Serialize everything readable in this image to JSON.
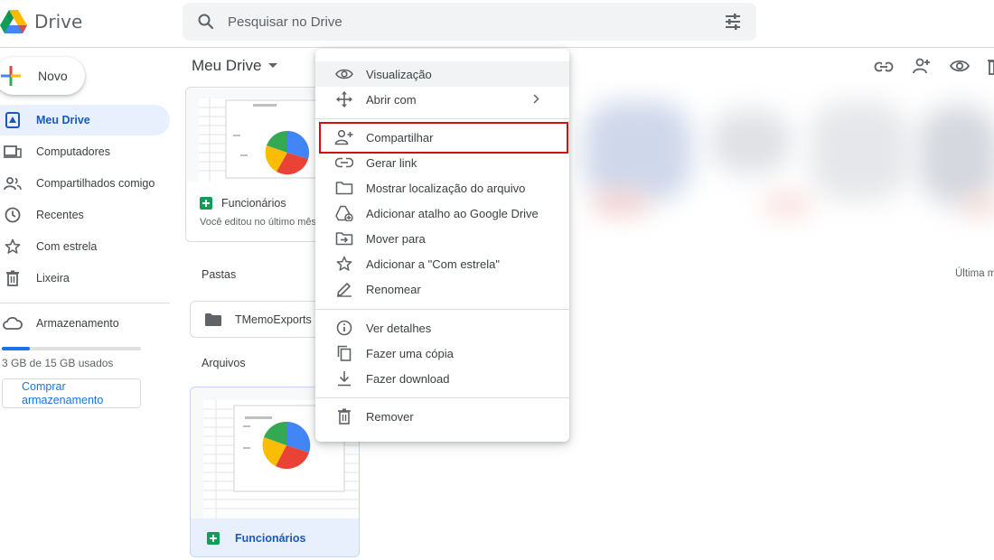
{
  "app": {
    "name": "Drive"
  },
  "search": {
    "placeholder": "Pesquisar no Drive"
  },
  "sidebar": {
    "new_label": "Novo",
    "items": [
      {
        "label": "Meu Drive",
        "icon": "my-drive-icon",
        "active": true
      },
      {
        "label": "Computadores",
        "icon": "computer-icon"
      },
      {
        "label": "Compartilhados comigo",
        "icon": "people-icon"
      },
      {
        "label": "Recentes",
        "icon": "clock-icon"
      },
      {
        "label": "Com estrela",
        "icon": "star-icon"
      },
      {
        "label": "Lixeira",
        "icon": "trash-icon"
      }
    ],
    "storage": {
      "label": "Armazenamento",
      "usage_text": "3 GB de 15 GB usados",
      "used_fraction": 0.2,
      "buy_label": "Comprar armazenamento"
    }
  },
  "main": {
    "title": "Meu Drive",
    "toolbar_icons": [
      "link-icon",
      "add-person-icon",
      "eye-icon",
      "trash-icon"
    ],
    "suggested": {
      "file_name": "Funcionários",
      "subtitle": "Você editou no último mês"
    },
    "folders_label": "Pastas",
    "folders": [
      {
        "name": "TMemoExports"
      }
    ],
    "files_label": "Arquivos",
    "files": [
      {
        "name": "Funcionários"
      }
    ],
    "sort_label": "Última m"
  },
  "context_menu": {
    "items": [
      {
        "label": "Visualização",
        "icon": "eye-icon"
      },
      {
        "label": "Abrir com",
        "icon": "move-arrows-icon",
        "submenu": true
      },
      {
        "label": "Compartilhar",
        "icon": "add-person-icon",
        "highlighted": true
      },
      {
        "label": "Gerar link",
        "icon": "link-icon"
      },
      {
        "label": "Mostrar localização do arquivo",
        "icon": "folder-icon"
      },
      {
        "label": "Adicionar atalho ao Google Drive",
        "icon": "add-shortcut-icon"
      },
      {
        "label": "Mover para",
        "icon": "move-to-folder-icon"
      },
      {
        "label": "Adicionar a \"Com estrela\"",
        "icon": "star-icon"
      },
      {
        "label": "Renomear",
        "icon": "pencil-icon"
      },
      {
        "label": "Ver detalhes",
        "icon": "info-icon"
      },
      {
        "label": "Fazer uma cópia",
        "icon": "copy-icon"
      },
      {
        "label": "Fazer download",
        "icon": "download-icon"
      },
      {
        "label": "Remover",
        "icon": "trash-icon"
      }
    ]
  },
  "colors": {
    "accent": "#1a73e8",
    "highlight_border": "#d40f0f",
    "active_nav_bg": "#e8f0fe",
    "sheets_green": "#0f9d58"
  }
}
